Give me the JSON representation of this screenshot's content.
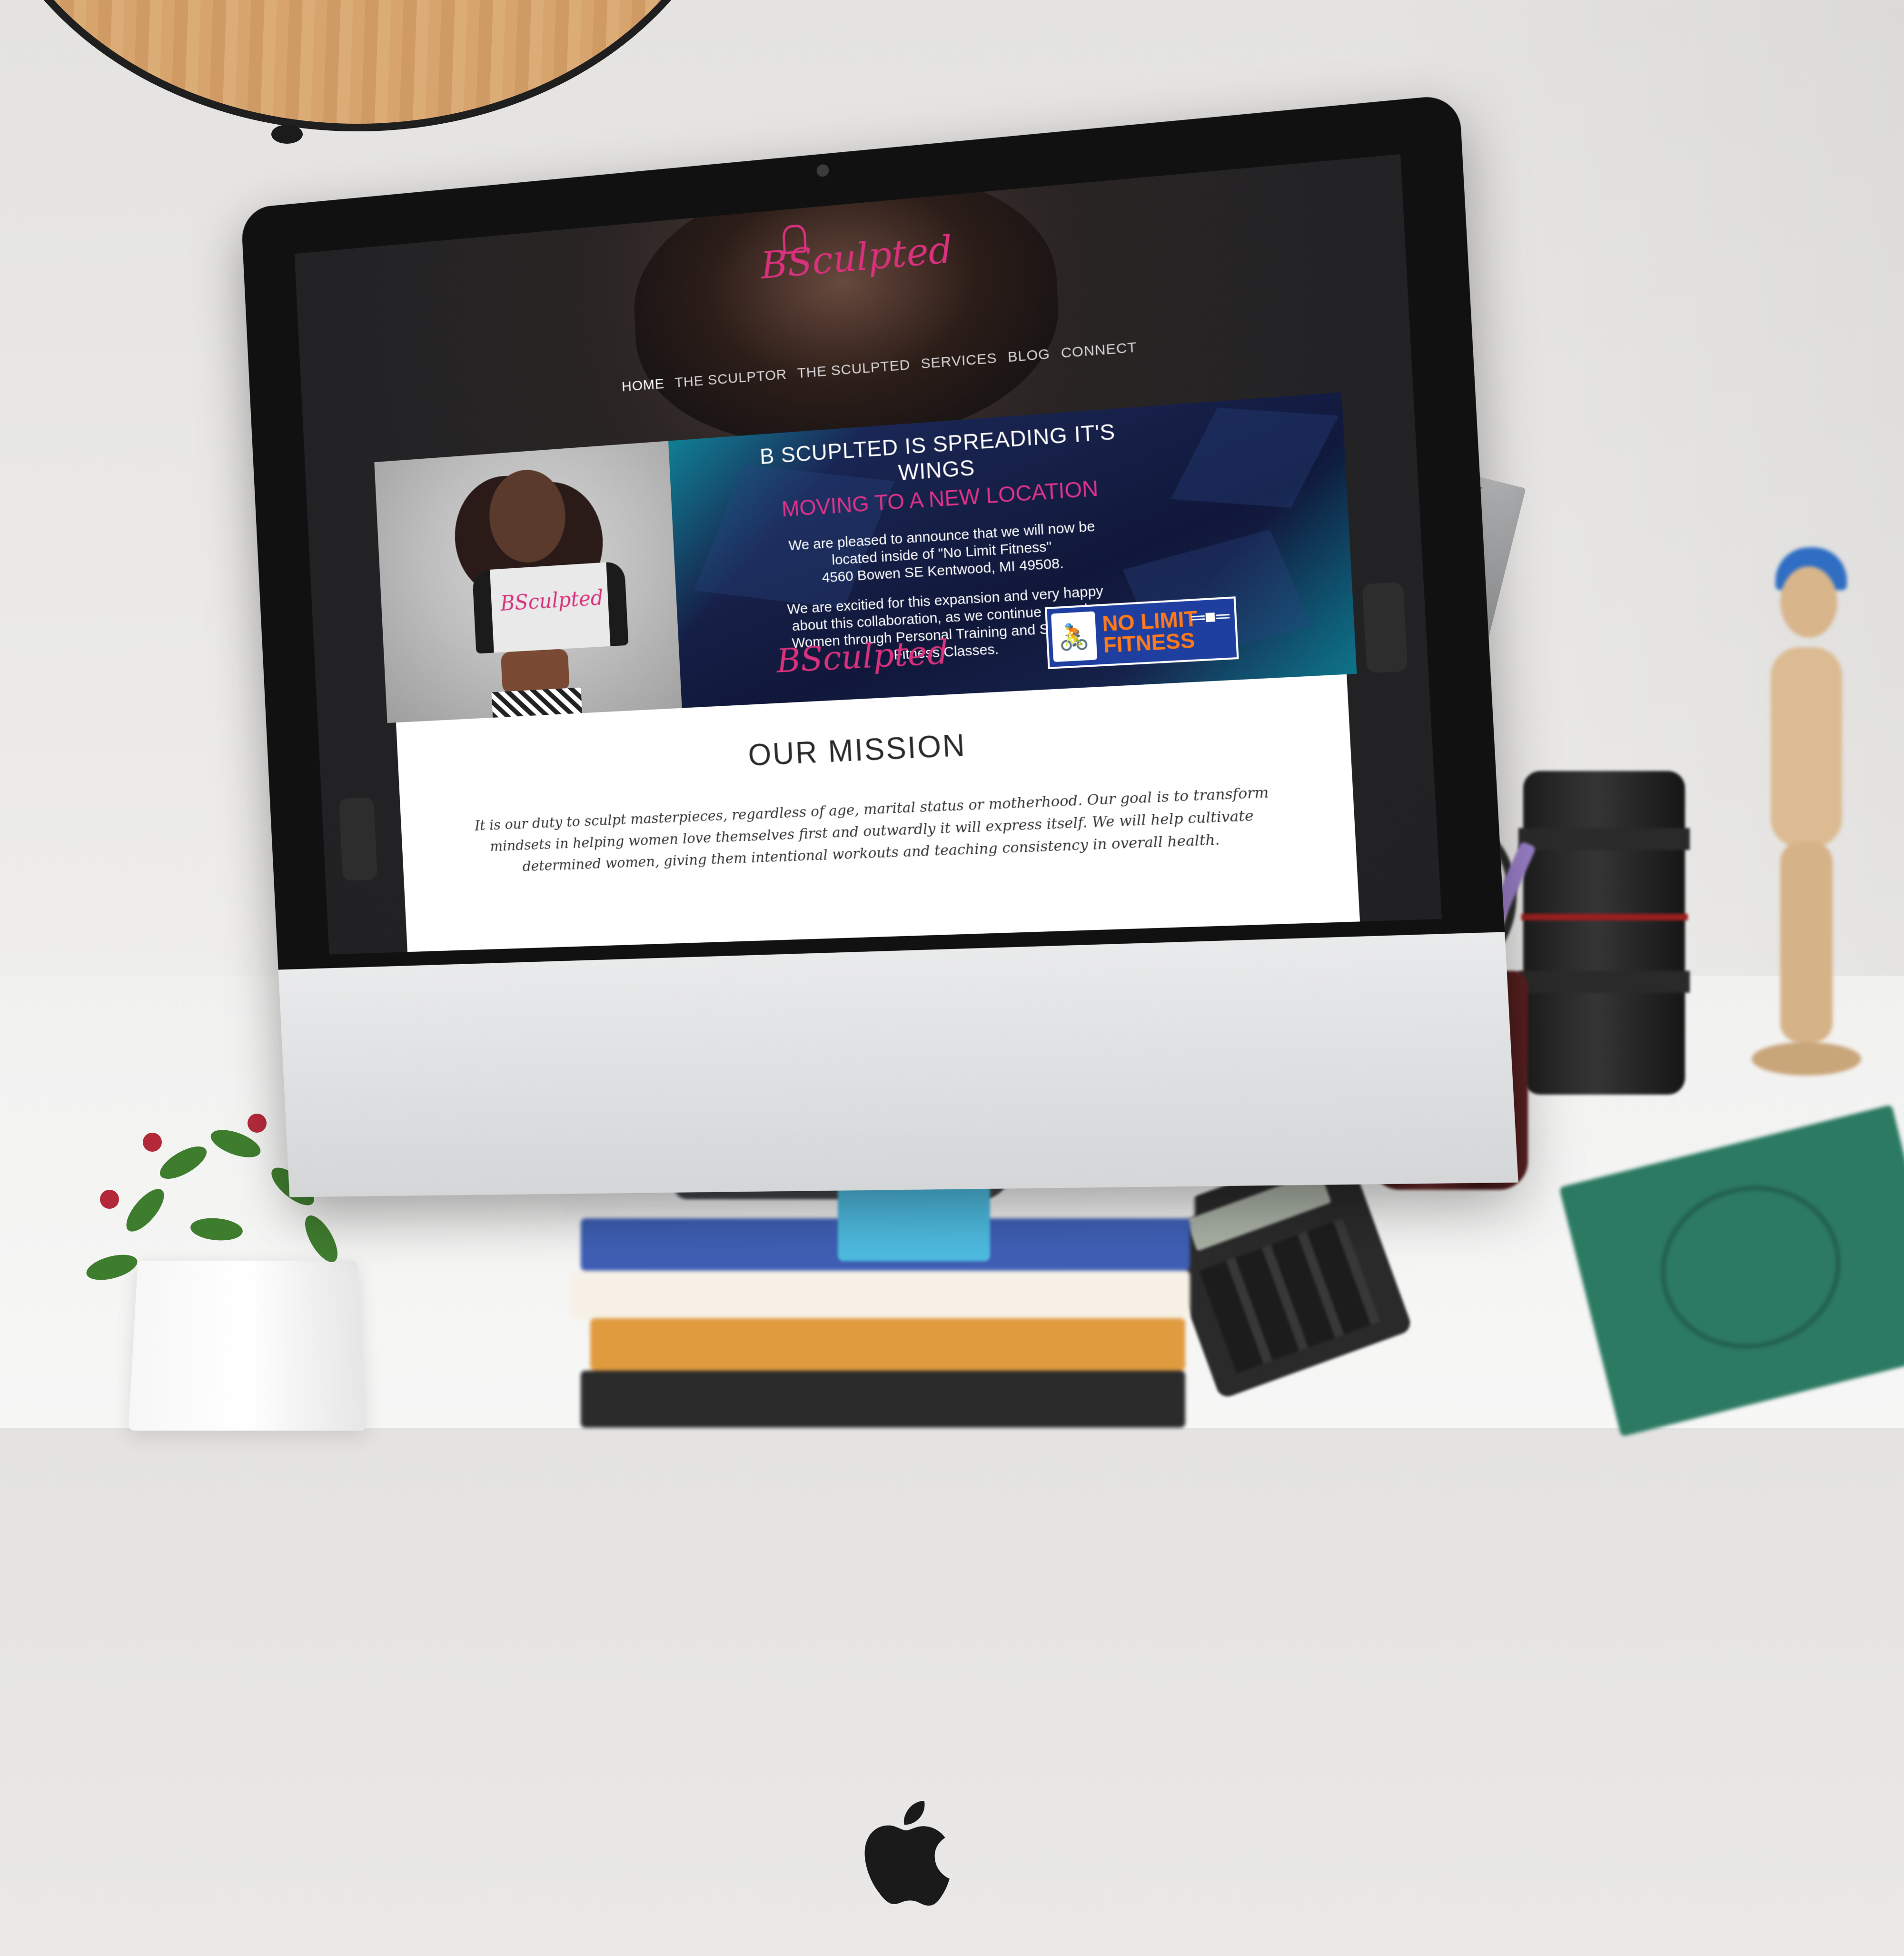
{
  "site": {
    "logo_text": "BSculpted",
    "nav": [
      {
        "label": "HOME",
        "active": true
      },
      {
        "label": "THE SCULPTOR",
        "active": false
      },
      {
        "label": "THE SCULPTED",
        "active": false
      },
      {
        "label": "SERVICES",
        "active": false
      },
      {
        "label": "BLOG",
        "active": false
      },
      {
        "label": "CONNECT",
        "active": false
      }
    ],
    "banner": {
      "shirt_text": "BSculpted",
      "headline": "B SCUPLTED IS SPREADING IT'S WINGS",
      "subheadline": "MOVING TO A NEW LOCATION",
      "announcement_lines": [
        "We are pleased to announce that we will now be",
        "located inside of \"No Limit Fitness\"",
        "4560 Bowen SE Kentwood, MI 49508."
      ],
      "expansion_lines": [
        "We are excitied for this expansion and very happy",
        "about this collaboration, as we continue to sculpt",
        "Women through Personal Training and Signature",
        "Fitness Classes."
      ],
      "logo_text": "BSculpted",
      "partner_logo": {
        "line1": "NO LIMIT",
        "line2": "FITNESS"
      }
    },
    "mission": {
      "title": "OUR MISSION",
      "body": "It is our duty to sculpt masterpieces, regardless of age, marital status or motherhood. Our goal is to transform mindsets in helping women love themselves first and outwardly it will express itself. We will help cultivate determined women, giving them intentional workouts and teaching consistency in overall health."
    }
  },
  "colors": {
    "accent_pink": "#d9317d",
    "banner_blue": "#162048",
    "teal": "#00e5d5",
    "partner_orange": "#ff7a1a",
    "partner_blue": "#1f3fa0"
  },
  "icons": {
    "device_logo": "apple-logo-icon",
    "partner_icon": "exercise-bike-icon",
    "partner_dumbbell": "dumbbell-icon"
  }
}
